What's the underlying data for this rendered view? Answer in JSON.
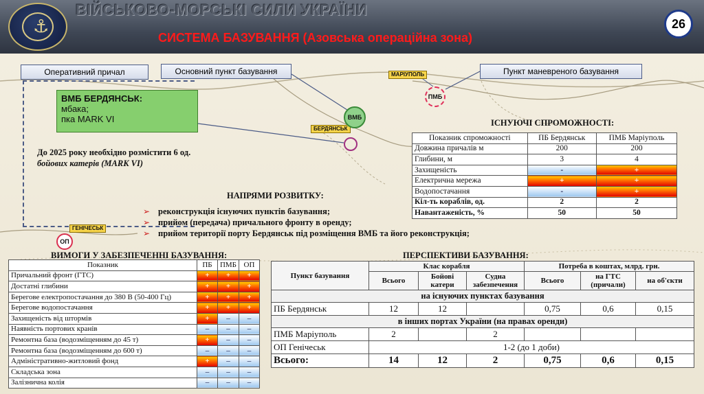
{
  "header": {
    "title": "ВІЙСЬКОВО-МОРСЬКІ СИЛИ УКРАЇНИ",
    "subtitle": "СИСТЕМА БАЗУВАННЯ  (Азовська операційна зона)",
    "page_number": "26"
  },
  "callouts": {
    "operative": "Оперативний причал",
    "main_base": "Основний пункт базування",
    "maneuver": "Пункт маневреного базування"
  },
  "green_box": {
    "title": "ВМБ  БЕРДЯНСЬК:",
    "line1": "мбака;",
    "line2": "пка MARK VI"
  },
  "note": {
    "line1": "До 2025 року необхідно розмістити 6 од.",
    "line2": "бойових катерів (MARK VI)"
  },
  "map_labels": {
    "mariupol": "МАРІУПОЛЬ",
    "berdyansk": "БЕРДЯНСЬК",
    "genichesk": "ГЕНІЧЕСЬК",
    "vmb": "ВМБ",
    "pmb": "ПМБ",
    "op": "ОП"
  },
  "directions": {
    "title": "НАПРЯМИ РОЗВИТКУ:",
    "items": [
      "реконструкція існуючих пунктів базування;",
      "прийом (передача) причального фронту в оренду;",
      "прийом території порту Бердянськ під розміщення ВМБ та його реконструкція;"
    ]
  },
  "capabilities": {
    "title": "ІСНУЮЧІ СПРОМОЖНОСТІ:",
    "headers": [
      "Показник спроможності",
      "ПБ Бердянськ",
      "ПМБ Маріуполь"
    ],
    "rows": [
      {
        "label": "Довжина причалів м",
        "a": "200",
        "b": "200",
        "ta": "val",
        "tb": "val"
      },
      {
        "label": "Глибини, м",
        "a": "3",
        "b": "4",
        "ta": "val",
        "tb": "val"
      },
      {
        "label": "Захищеність",
        "a": "-",
        "b": "+",
        "ta": "minus",
        "tb": "plus"
      },
      {
        "label": "Електрична мережа",
        "a": "+",
        "b": "+",
        "ta": "plus",
        "tb": "plus"
      },
      {
        "label": "Водопостачання",
        "a": "-",
        "b": "+",
        "ta": "minus",
        "tb": "plus"
      },
      {
        "label": "Кіл-ть кораблів, од.",
        "a": "2",
        "b": "2",
        "ta": "val",
        "tb": "val",
        "bold": true
      },
      {
        "label": "Навантаженість, %",
        "a": "50",
        "b": "50",
        "ta": "val",
        "tb": "val",
        "bold": true
      }
    ]
  },
  "requirements": {
    "title": "ВИМОГИ У ЗАБЕЗПЕЧЕННІ БАЗУВАННЯ:",
    "headers": [
      "Показник",
      "ПБ",
      "ПМБ",
      "ОП"
    ],
    "rows": [
      {
        "label": "Причальний фронт (ГТС)",
        "v": [
          "+",
          "+",
          "+"
        ]
      },
      {
        "label": "Достатні глибини",
        "v": [
          "+",
          "+",
          "+"
        ]
      },
      {
        "label": "Берегове електропостачання до 380 В (50-400 Гц)",
        "v": [
          "+",
          "+",
          "+"
        ]
      },
      {
        "label": "Берегове водопостачання",
        "v": [
          "+",
          "+",
          "+"
        ]
      },
      {
        "label": "Захищеність від штормів",
        "v": [
          "+",
          "–",
          "–"
        ]
      },
      {
        "label": "Наявність портових кранів",
        "v": [
          "–",
          "–",
          "–"
        ]
      },
      {
        "label": "Ремонтна база (водозміщенням до 45 т)",
        "v": [
          "+",
          "–",
          "–"
        ]
      },
      {
        "label": "Ремонтна база (водозміщенням до 600 т)",
        "v": [
          "–",
          "–",
          "–"
        ]
      },
      {
        "label": "Адміністративно-житловий фонд",
        "v": [
          "+",
          "–",
          "–"
        ]
      },
      {
        "label": "Складська зона",
        "v": [
          "–",
          "–",
          "–"
        ]
      },
      {
        "label": "Залізнична колія",
        "v": [
          "–",
          "–",
          "–"
        ]
      }
    ]
  },
  "perspectives": {
    "title": "ПЕРСПЕКТИВИ БАЗУВАННЯ:",
    "h_point": "Пункт базування",
    "h_class": "Клас корабля",
    "h_need": "Потреба в коштах, млрд. грн.",
    "h_total": "Всього",
    "h_combat": "Бойові катери",
    "h_support": "Судна забезпечення",
    "h_total2": "Всього",
    "h_gts": "на ГТС (причали)",
    "h_objects": "на об'єкти",
    "section1": "на існуючих пунктах базування",
    "row_berd": {
      "name": "ПБ Бердянськ",
      "total": "12",
      "combat": "12",
      "support": "",
      "need_total": "0,75",
      "gts": "0,6",
      "objects": "0,15"
    },
    "section2": "в інших портах України (на правах оренди)",
    "row_mar": {
      "name": "ПМБ Маріуполь",
      "total": "2",
      "combat": "",
      "support": "2",
      "need_total": "",
      "gts": "",
      "objects": ""
    },
    "row_gen": {
      "name": "ОП Генічеськ",
      "span": "1-2 (до 1 доби)"
    },
    "row_sum": {
      "name": "Всього:",
      "total": "14",
      "combat": "12",
      "support": "2",
      "need_total": "0,75",
      "gts": "0,6",
      "objects": "0,15"
    }
  }
}
